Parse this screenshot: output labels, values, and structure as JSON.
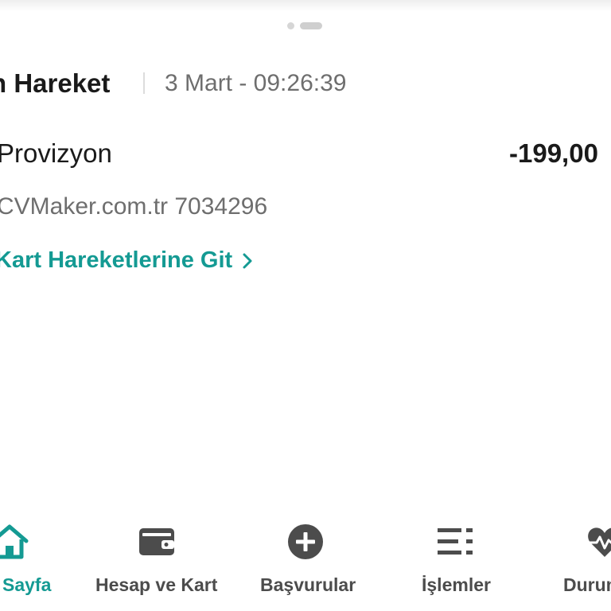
{
  "header": {
    "title": "n Hareket",
    "datetime": "3 Mart - 09:26:39"
  },
  "transaction": {
    "type": "Provizyon",
    "amount": "-199,00",
    "merchant": "CVMaker.com.tr 7034296"
  },
  "link": {
    "label": "Kart Hareketlerine Git",
    "icon": "chevron-right-icon"
  },
  "bottom_nav": {
    "active_color": "#149a93",
    "inactive_color": "#4c4c4c",
    "items": [
      {
        "label": "Sayfa",
        "icon": "home-icon",
        "active": true
      },
      {
        "label": "Hesap ve Kart",
        "icon": "wallet-icon",
        "active": false
      },
      {
        "label": "Başvurular",
        "icon": "plus-circle-icon",
        "active": false
      },
      {
        "label": "İşlemler",
        "icon": "list-icon",
        "active": false
      },
      {
        "label": "Durum",
        "icon": "heart-pulse-icon",
        "active": false
      }
    ]
  }
}
